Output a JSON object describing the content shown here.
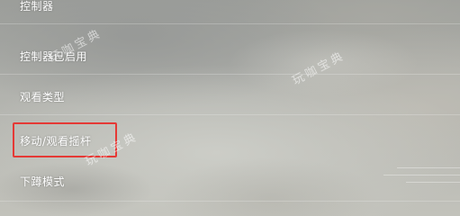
{
  "menu": {
    "items": [
      {
        "label": "控制器"
      },
      {
        "label": "控制器已启用"
      },
      {
        "label": "观看类型"
      },
      {
        "label": "移动/观看摇杆"
      },
      {
        "label": "下蹲模式"
      }
    ],
    "selected_index": 3
  },
  "watermark": {
    "text": "玩咖宝典"
  },
  "colors": {
    "highlight": "#e53935",
    "text": "#ffffff"
  }
}
